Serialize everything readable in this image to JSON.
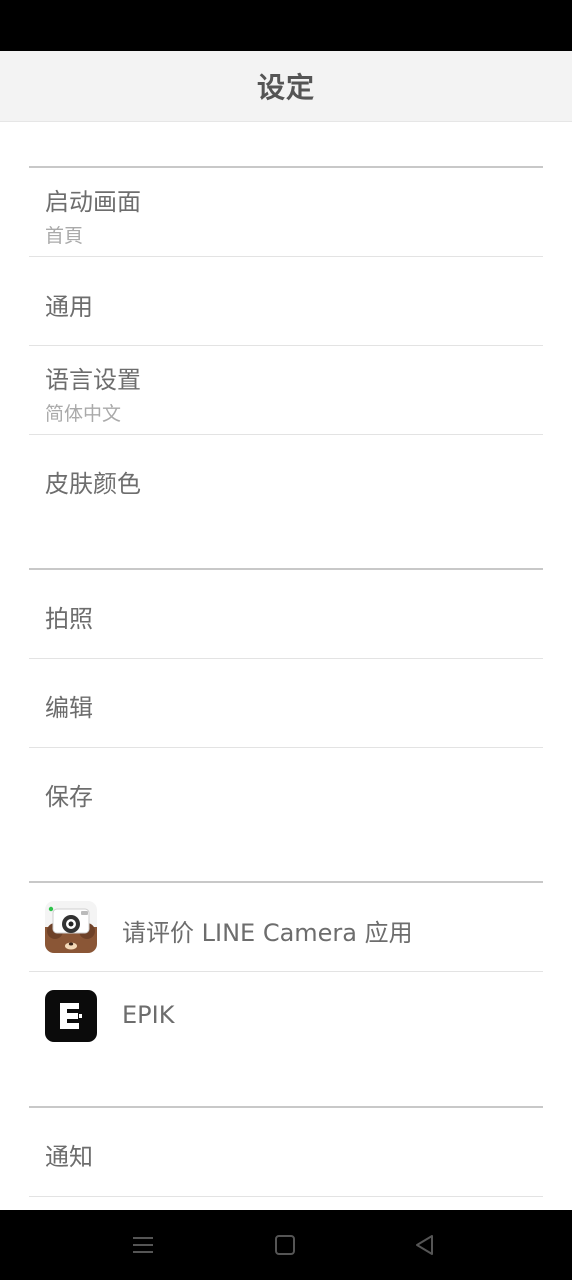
{
  "header": {
    "title": "设定"
  },
  "sections": [
    {
      "items": [
        {
          "label": "启动画面",
          "value": "首頁"
        },
        {
          "label": "通用"
        },
        {
          "label": "语言设置",
          "value": "简体中文"
        },
        {
          "label": "皮肤颜色"
        }
      ]
    },
    {
      "items": [
        {
          "label": "拍照"
        },
        {
          "label": "编辑"
        },
        {
          "label": "保存"
        }
      ]
    },
    {
      "items": [
        {
          "label": "请评价 LINE Camera 应用",
          "icon": "line-camera-bear-icon"
        },
        {
          "label": "EPIK",
          "icon": "epik-icon"
        }
      ]
    },
    {
      "items": [
        {
          "label": "通知"
        }
      ]
    }
  ],
  "navbar": {
    "icons": [
      "menu-icon",
      "home-square-icon",
      "back-triangle-icon"
    ]
  },
  "colors": {
    "header_bg": "#f3f3f3",
    "text": "#6d6d6d",
    "subtext": "#aaaaaa",
    "divider": "#c8c8c8"
  }
}
